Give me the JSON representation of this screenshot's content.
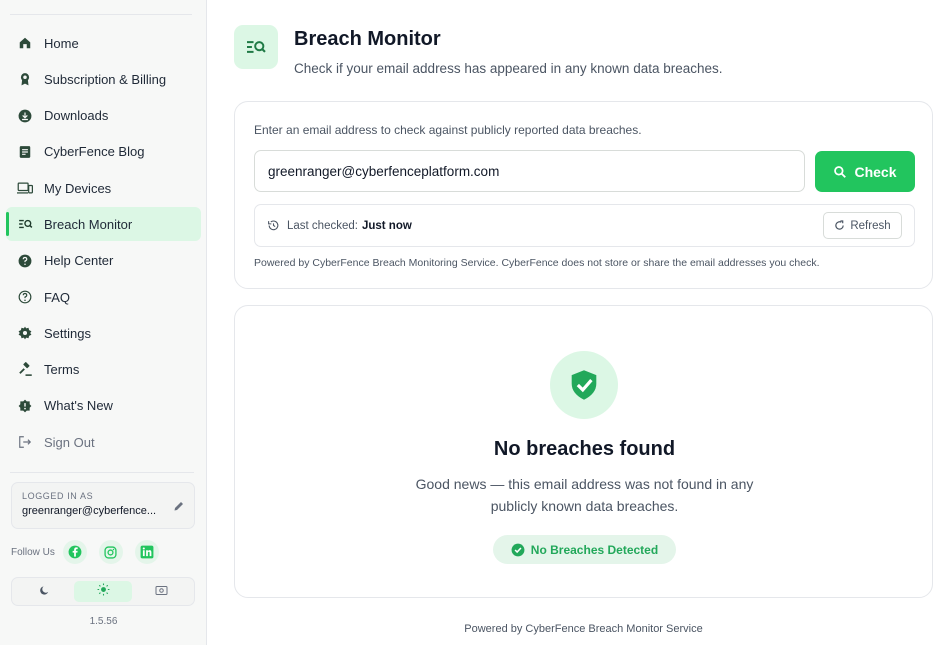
{
  "sidebar": {
    "items": [
      {
        "label": "Home",
        "icon": "home-icon"
      },
      {
        "label": "Subscription & Billing",
        "icon": "badge-icon"
      },
      {
        "label": "Downloads",
        "icon": "download-icon"
      },
      {
        "label": "CyberFence Blog",
        "icon": "blog-icon"
      },
      {
        "label": "My Devices",
        "icon": "devices-icon"
      },
      {
        "label": "Breach Monitor",
        "icon": "breach-monitor-icon",
        "active": true
      },
      {
        "label": "Help Center",
        "icon": "help-icon"
      },
      {
        "label": "FAQ",
        "icon": "faq-icon"
      },
      {
        "label": "Settings",
        "icon": "gear-icon"
      },
      {
        "label": "Terms",
        "icon": "gavel-icon"
      },
      {
        "label": "What's New",
        "icon": "new-icon"
      },
      {
        "label": "Sign Out",
        "icon": "sign-out-icon"
      }
    ],
    "logged_in_label": "LOGGED IN AS",
    "logged_in_email": "greenranger@cyberfence...",
    "follow_label": "Follow Us",
    "socials": [
      "facebook-icon",
      "instagram-icon",
      "linkedin-icon"
    ],
    "theme_options": [
      "moon-icon",
      "sun-icon",
      "system-icon"
    ],
    "theme_selected": "sun-icon",
    "version": "1.5.56"
  },
  "header": {
    "title": "Breach Monitor",
    "subtitle": "Check if your email address has appeared in any known data breaches."
  },
  "check_card": {
    "instructions": "Enter an email address to check against publicly reported data breaches.",
    "email_value": "greenranger@cyberfenceplatform.com",
    "check_label": "Check",
    "last_checked_label": "Last checked:",
    "last_checked_value": "Just now",
    "refresh_label": "Refresh",
    "powered_note": "Powered by CyberFence Breach Monitoring Service. CyberFence does not store or share the email addresses you check."
  },
  "result_card": {
    "title": "No breaches found",
    "message": "Good news — this email address was not found in any publicly known data breaches.",
    "badge": "No Breaches Detected"
  },
  "footer": "Powered by CyberFence Breach Monitor Service",
  "colors": {
    "accent": "#22c55e",
    "accent_light": "#dcf7e5",
    "sidebar_bg": "#f7f8f7",
    "text": "#1f2937"
  }
}
